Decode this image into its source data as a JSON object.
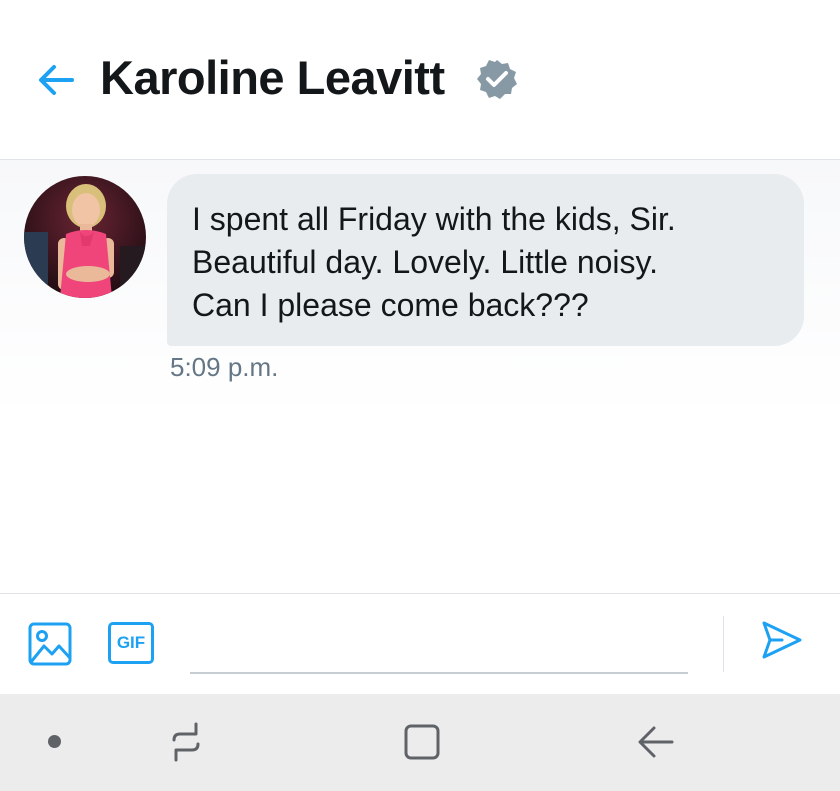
{
  "header": {
    "contact_name": "Karoline Leavitt",
    "verified": true,
    "accent_color": "#1da1f2"
  },
  "conversation": {
    "messages": [
      {
        "direction": "incoming",
        "avatar_icon": "contact-avatar",
        "lines": [
          "I spent all Friday with the kids, Sir.",
          "Beautiful day. Lovely. Little noisy.",
          "Can I please come back???"
        ],
        "time": "5:09 p.m."
      }
    ]
  },
  "composer": {
    "media_icon": "image-icon",
    "gif_label": "GIF",
    "input_value": "",
    "input_placeholder": "",
    "send_icon": "send-icon"
  },
  "navbar": {
    "icons": [
      "dot-icon",
      "recents-icon",
      "home-icon",
      "back-icon"
    ]
  }
}
